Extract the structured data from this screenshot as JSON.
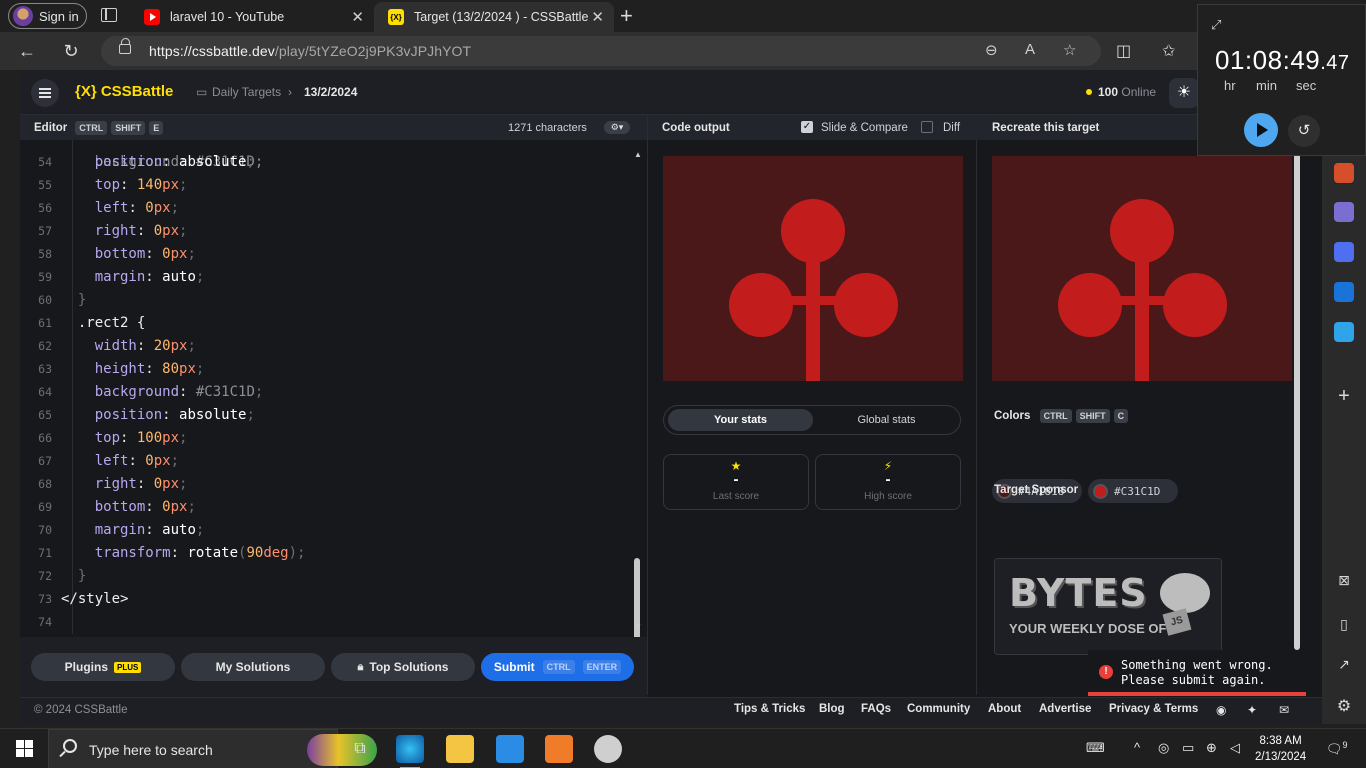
{
  "browser": {
    "profile_label": "Sign in",
    "tabs": [
      {
        "title": "laravel 10 - YouTube",
        "favicon": "youtube-icon"
      },
      {
        "title": "Target (13/2/2024 ) - CSSBattle",
        "favicon": "cssbattle-icon"
      }
    ],
    "favicon_text": "{X}",
    "url_host": "https://cssbattle.dev",
    "url_path": "/play/5tYZeO2j9PK3vJPJhYOT"
  },
  "topbar": {
    "logo": "{X} CSSBattle",
    "breadcrumb_1": "Daily Targets",
    "breadcrumb_2": "13/2/2024",
    "online_count": "100",
    "online_label": "Online"
  },
  "editor": {
    "title": "Editor",
    "keys": [
      "CTRL",
      "SHIFT",
      "E"
    ],
    "char_count": "1271 characters",
    "lines": [
      {
        "n": "54",
        "code": "    position: absolute;"
      },
      {
        "n": "55",
        "code": "    top: 140px;"
      },
      {
        "n": "56",
        "code": "    left: 0px;"
      },
      {
        "n": "57",
        "code": "    right: 0px;"
      },
      {
        "n": "58",
        "code": "    bottom: 0px;"
      },
      {
        "n": "59",
        "code": "    margin: auto;"
      },
      {
        "n": "60",
        "code": "  }"
      },
      {
        "n": "61",
        "code": "  .rect2 {"
      },
      {
        "n": "62",
        "code": "    width: 20px;"
      },
      {
        "n": "63",
        "code": "    height: 80px;"
      },
      {
        "n": "64",
        "code": "    background: #C31C1D;"
      },
      {
        "n": "65",
        "code": "    position: absolute;"
      },
      {
        "n": "66",
        "code": "    top: 100px;"
      },
      {
        "n": "67",
        "code": "    left: 0px;"
      },
      {
        "n": "68",
        "code": "    right: 0px;"
      },
      {
        "n": "69",
        "code": "    bottom: 0px;"
      },
      {
        "n": "70",
        "code": "    margin: auto;"
      },
      {
        "n": "71",
        "code": "    transform: rotate(90deg);"
      },
      {
        "n": "72",
        "code": "  }"
      },
      {
        "n": "73",
        "code": "</style>"
      },
      {
        "n": "74",
        "code": ""
      }
    ],
    "partial_top_line": "    background: #C31C1D;"
  },
  "buttons": {
    "plugins": "Plugins",
    "plus_badge": "PLUS",
    "my_solutions": "My Solutions",
    "top_solutions": "Top Solutions",
    "submit": "Submit",
    "submit_keys": [
      "CTRL",
      "ENTER"
    ]
  },
  "output": {
    "title": "Code output",
    "slide_compare": "Slide & Compare",
    "diff": "Diff",
    "stats_tabs": [
      "Your stats",
      "Global stats"
    ],
    "last_score_value": "-",
    "last_score_label": "Last score",
    "high_score_value": "-",
    "high_score_label": "High score"
  },
  "target": {
    "title": "Recreate this target",
    "colors_title": "Colors",
    "colors_keys": [
      "CTRL",
      "SHIFT",
      "C"
    ],
    "colors": [
      {
        "hex": "#4A1818"
      },
      {
        "hex": "#C31C1D"
      }
    ],
    "sponsor_title": "Target Sponsor",
    "sponsor_big": "BYTES",
    "sponsor_small": "YOUR WEEKLY DOSE OF",
    "sponsor_js": "JS"
  },
  "footer": {
    "copyright": "© 2024 CSSBattle",
    "links": [
      "Tips & Tricks",
      "Blog",
      "FAQs",
      "Community",
      "About",
      "Advertise",
      "Privacy & Terms"
    ]
  },
  "toast": {
    "line1": "Something went wrong.",
    "line2": "Please submit again."
  },
  "timer": {
    "hours": "01",
    "minutes": "08",
    "seconds": "49",
    "fraction": ".47",
    "labels": [
      "hr",
      "min",
      "sec"
    ]
  },
  "taskbar": {
    "search_placeholder": "Type here to search",
    "time": "8:38 AM",
    "date": "2/13/2024",
    "notification_count": "9"
  },
  "colors": {
    "bg": "#4A1818",
    "shape": "#C31C1D",
    "accent": "#FFDF00",
    "submit": "#1E6EE8"
  }
}
